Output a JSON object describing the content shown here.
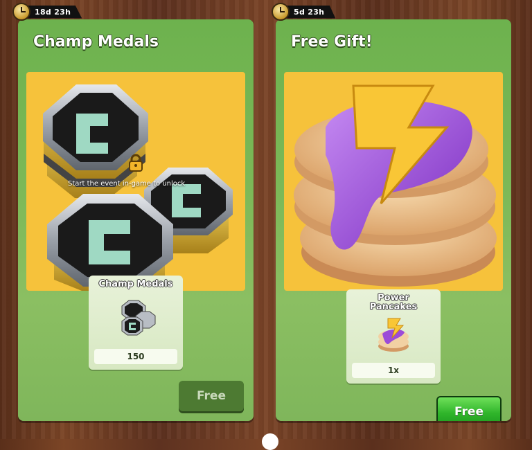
{
  "cards": [
    {
      "timer": "18d 23h",
      "title": "Champ Medals",
      "lock_message": "Start the event in-game to unlock",
      "item": {
        "name": "Champ Medals",
        "quantity": "150",
        "icon": "champ-medals-icon"
      },
      "button": {
        "label": "Free",
        "state": "disabled"
      }
    },
    {
      "timer": "5d 23h",
      "title": "Free Gift!",
      "item": {
        "name": "Power Pancakes",
        "quantity": "1x",
        "icon": "power-pancakes-icon"
      },
      "button": {
        "label": "Free",
        "state": "active"
      }
    }
  ],
  "colors": {
    "card_green": "#7bb857",
    "art_yellow": "#f6c23b",
    "button_green": "#2fb52a",
    "wood": "#6b3a20"
  }
}
